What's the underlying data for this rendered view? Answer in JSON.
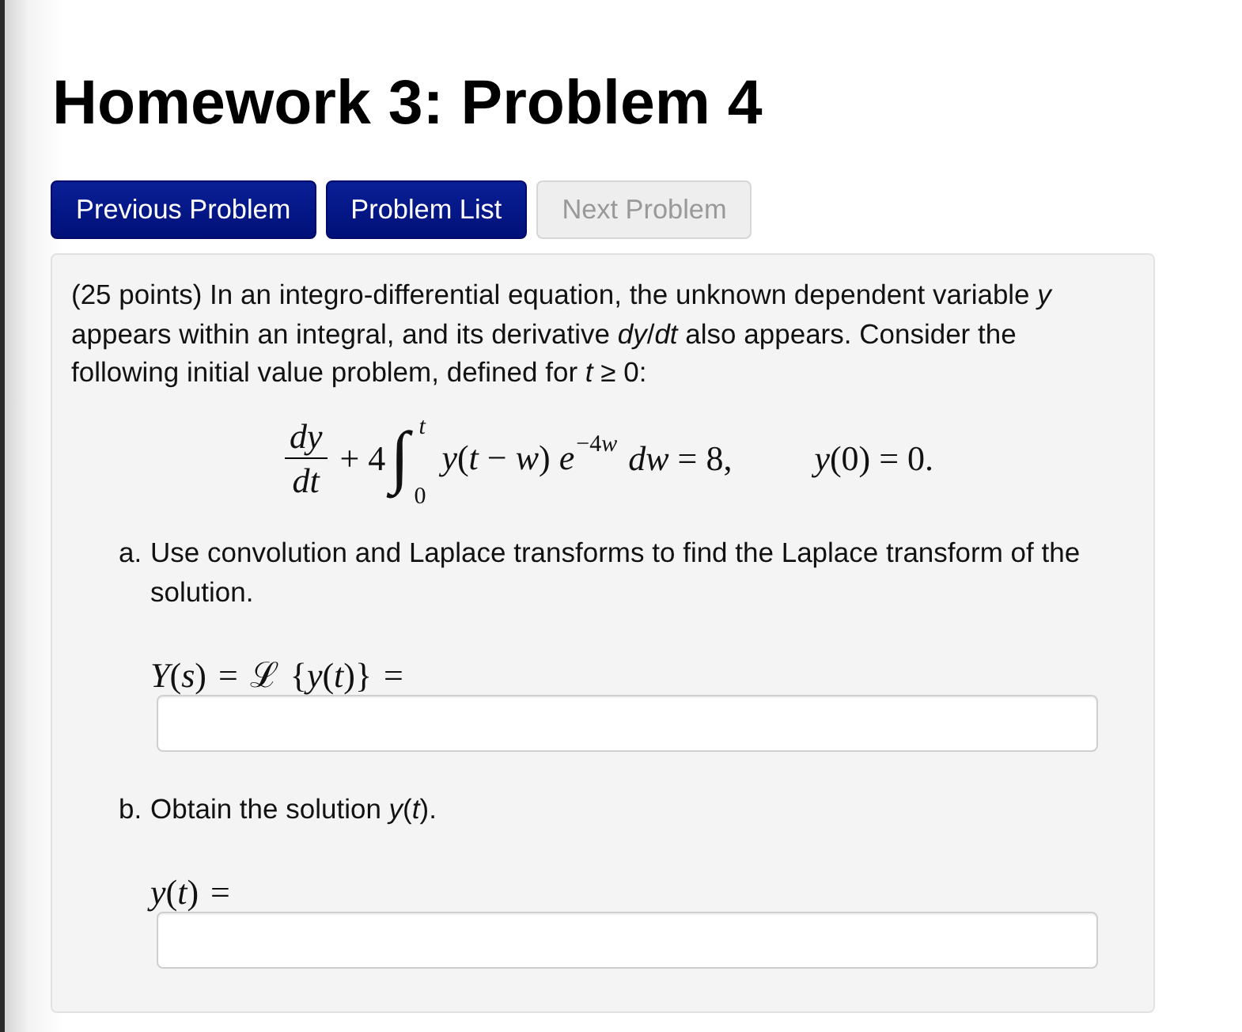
{
  "title": "Homework 3: Problem 4",
  "buttons": [
    {
      "label": "Previous Problem",
      "disabled": false
    },
    {
      "label": "Problem List",
      "disabled": false
    },
    {
      "label": "Next Problem",
      "disabled": true
    }
  ],
  "problem": {
    "statement": "(25 points) In an integro-differential equation, the unknown dependent variable *y* appears within an integral, and its derivative *dy*/*dt* also appears. Consider the following initial value problem, defined for *t* ≥ 0:",
    "equation": {
      "numerator": "*dy*",
      "denominator": "*dt*",
      "coefficient": "+ 4",
      "integral_sign": "∫",
      "upper_limit": "t",
      "lower_limit": "0",
      "integrand": "*y*(*t* − *w*) *e*",
      "exponent_number": "−4",
      "exponent_variable": "w",
      "differential": "*dw* = 8,",
      "condition": "*y*(0) = 0."
    },
    "parts": [
      {
        "label": "a.",
        "question": "Use convolution and Laplace transforms to find the Laplace transform of the solution.",
        "answer_label": "*Y*(*s*) = ℒ {*y*(*t*)} ="
      },
      {
        "label": "b.",
        "question": "Obtain the solution *y*(*t*).",
        "answer_label": "*y*(*t*) ="
      }
    ]
  }
}
